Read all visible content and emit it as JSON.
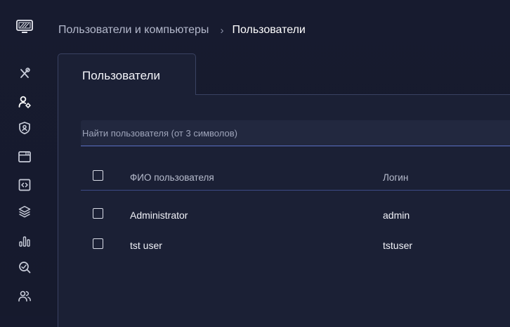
{
  "breadcrumb": {
    "parent": "Пользователи и компьютеры",
    "separator": "›",
    "current": "Пользователи"
  },
  "sidebar": {
    "logo_icon": "monitor-logo-icon",
    "items": [
      {
        "icon": "tools-icon",
        "active": false
      },
      {
        "icon": "user-settings-icon",
        "active": true
      },
      {
        "icon": "user-badge-icon",
        "active": false
      },
      {
        "icon": "browser-window-icon",
        "active": false
      },
      {
        "icon": "code-file-icon",
        "active": false
      },
      {
        "icon": "layers-icon",
        "active": false
      },
      {
        "icon": "bar-chart-icon",
        "active": false
      },
      {
        "icon": "search-scan-icon",
        "active": false
      },
      {
        "icon": "users-group-icon",
        "active": false
      }
    ]
  },
  "tabs": [
    {
      "label": "Пользователи",
      "active": true
    }
  ],
  "search": {
    "placeholder": "Найти пользователя (от 3 символов)",
    "value": ""
  },
  "table": {
    "columns": [
      "ФИО пользователя",
      "Логин"
    ],
    "rows": [
      {
        "name": "Administrator",
        "login": "admin",
        "checked": false
      },
      {
        "name": "tst user",
        "login": "tstuser",
        "checked": false
      }
    ]
  },
  "colors": {
    "background": "#161a2e",
    "panel": "#1b2035",
    "accent": "#5a6fc4",
    "text_muted": "#b4b9cc"
  }
}
